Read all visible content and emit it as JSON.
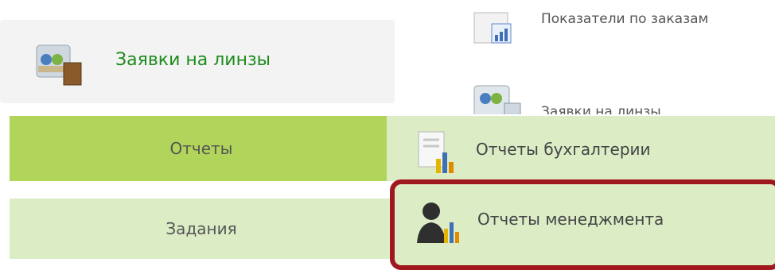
{
  "left_menu": {
    "lens_orders": {
      "label": "Заявки на линзы",
      "icon": "lens-orders-icon"
    },
    "reports": {
      "label": "Отчеты"
    },
    "tasks": {
      "label": "Задания"
    }
  },
  "submenu": {
    "order_metrics": {
      "label": "Показатели по заказам",
      "icon": "chart-document-icon"
    },
    "lens_orders": {
      "label": "Заявки на линзы",
      "icon": "lens-orders-icon"
    },
    "accounting_reports": {
      "label": "Отчеты бухгалтерии",
      "icon": "report-chart-icon"
    },
    "management_reports": {
      "label": "Отчеты менеджмента",
      "icon": "manager-chart-icon"
    }
  },
  "colors": {
    "reports_active": "#b1d55a",
    "menu_light_green": "#dcedc6",
    "highlight_border": "#a0181d",
    "lens_label_green": "#1e8b1e"
  }
}
